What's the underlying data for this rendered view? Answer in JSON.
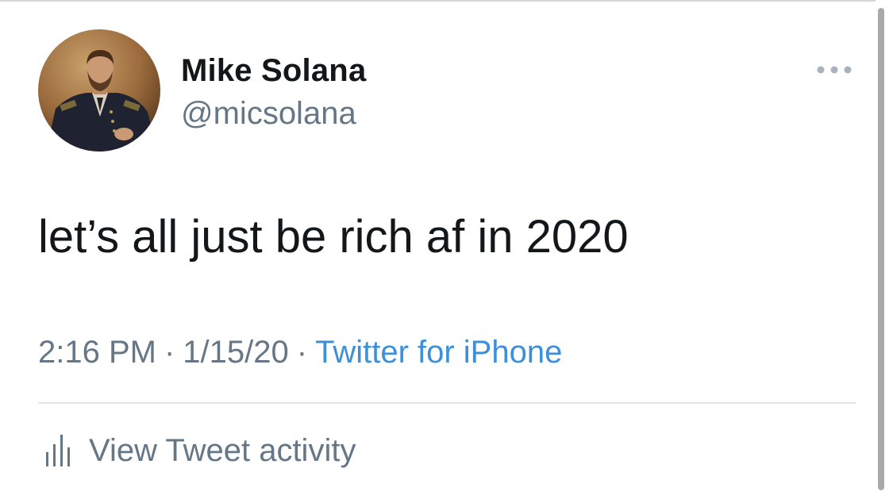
{
  "author": {
    "display_name": "Mike Solana",
    "handle": "@micsolana",
    "avatar_icon": "portrait-avatar"
  },
  "tweet": {
    "text": "let’s all just be rich af in 2020",
    "time": "2:16 PM",
    "date": "1/15/20",
    "separator": "·",
    "source": "Twitter for iPhone"
  },
  "actions": {
    "more_icon": "ellipsis-icon",
    "activity_label": "View Tweet activity",
    "activity_icon": "bar-chart-icon"
  },
  "colors": {
    "text_primary": "#14171a",
    "text_secondary": "#657786",
    "link": "#3d8fd9"
  }
}
